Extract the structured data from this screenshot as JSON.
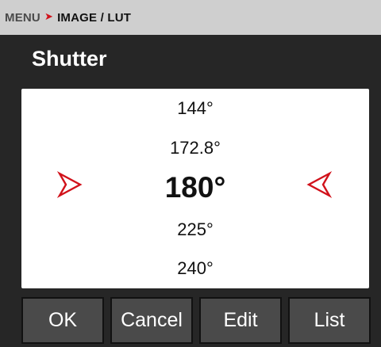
{
  "breadcrumb": {
    "root": "MENU",
    "current": "IMAGE / LUT"
  },
  "title": "Shutter",
  "picker": {
    "options": [
      "144°",
      "172.8°",
      "180°",
      "225°",
      "240°"
    ],
    "selected": "180°"
  },
  "buttons": {
    "ok": "OK",
    "cancel": "Cancel",
    "edit": "Edit",
    "list": "List"
  },
  "colors": {
    "accent": "#d1121b",
    "background": "#262626",
    "button": "#4a4a4a",
    "breadcrumb_bar": "#cfcfcf"
  },
  "icons": {
    "breadcrumb_separator": "chevron-right-icon",
    "selector_left": "arrow-right-outline-icon",
    "selector_right": "arrow-left-outline-icon"
  }
}
